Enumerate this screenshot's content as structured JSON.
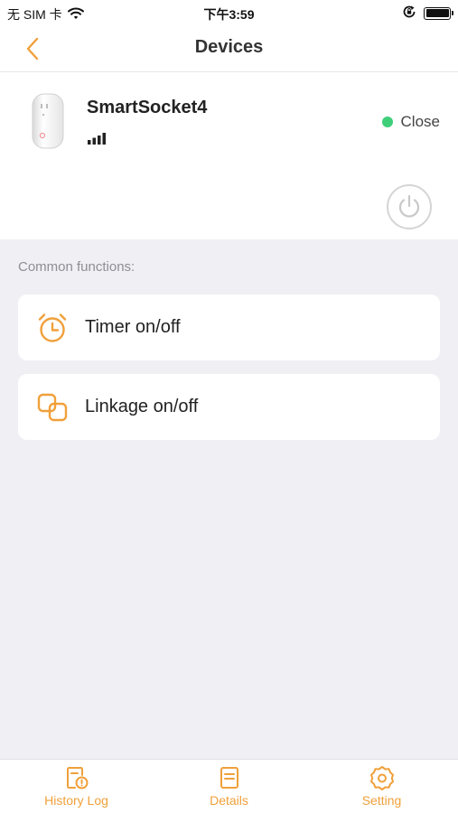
{
  "status_bar": {
    "carrier": "无 SIM 卡",
    "time": "下午3:59"
  },
  "nav": {
    "title": "Devices"
  },
  "device": {
    "name": "SmartSocket4",
    "status": "Close",
    "status_color": "#3fcf7a"
  },
  "common": {
    "label": "Common functions:",
    "items": [
      {
        "label": "Timer on/off",
        "icon": "alarm-clock-icon"
      },
      {
        "label": "Linkage on/off",
        "icon": "linkage-icon"
      }
    ]
  },
  "tabs": [
    {
      "label": "History Log",
      "icon": "history-log-icon"
    },
    {
      "label": "Details",
      "icon": "details-icon"
    },
    {
      "label": "Setting",
      "icon": "gear-icon"
    }
  ],
  "colors": {
    "accent": "#f0a03a",
    "background": "#efeff4"
  }
}
